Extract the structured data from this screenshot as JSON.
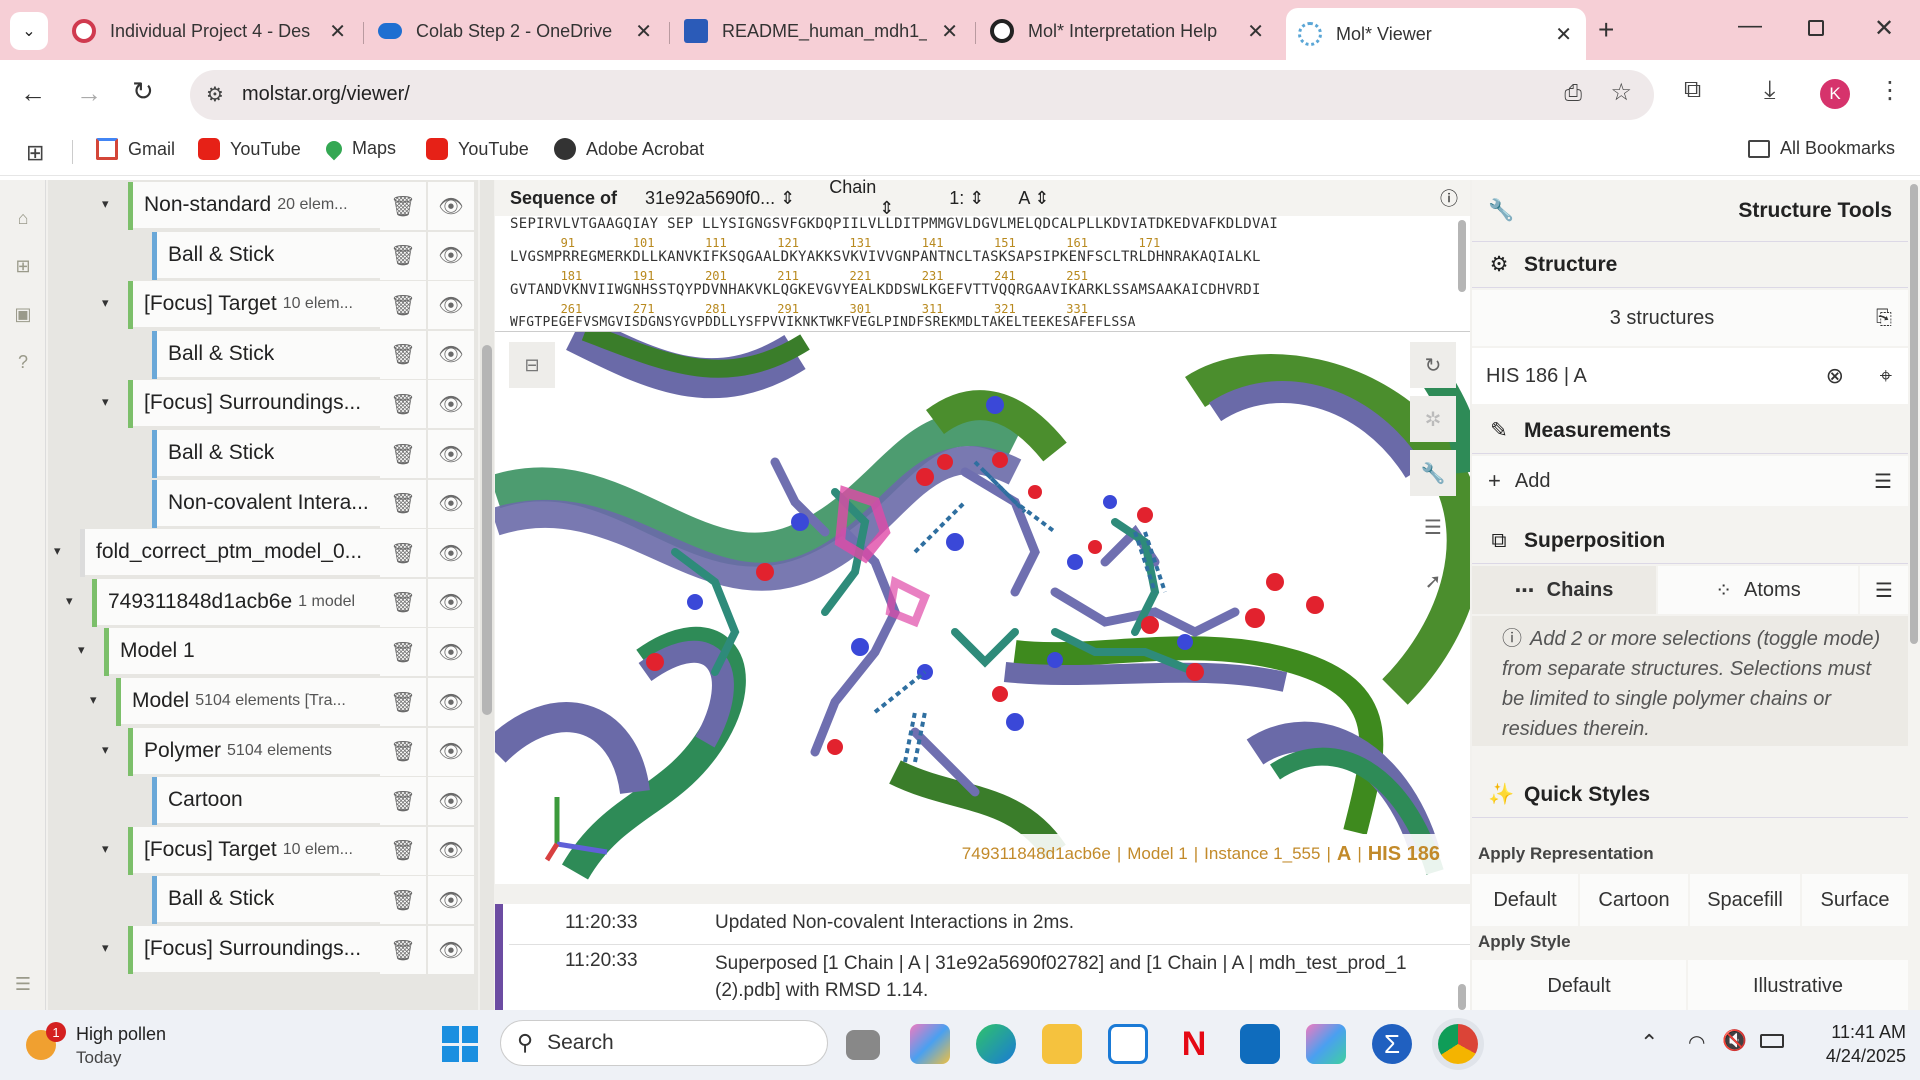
{
  "browser": {
    "tabs": [
      {
        "label": "Individual Project 4 - Des",
        "icon": "project-icon",
        "color": "#d03a4f"
      },
      {
        "label": "Colab Step 2 - OneDrive",
        "icon": "onedrive-icon",
        "color": "#1f6fd1"
      },
      {
        "label": "README_human_mdh1_",
        "icon": "word-icon",
        "color": "#2b5bb8"
      },
      {
        "label": "Mol* Interpretation Help",
        "icon": "chatgpt-icon",
        "color": "#222222"
      },
      {
        "label": "Mol* Viewer",
        "icon": "molstar-icon",
        "color": "#5aa6d6"
      }
    ],
    "url": "molstar.org/viewer/",
    "profile_initial": "K",
    "bookmarks": [
      "Gmail",
      "YouTube",
      "Maps",
      "YouTube",
      "Adobe Acrobat"
    ],
    "all_bookmarks": "All Bookmarks"
  },
  "tree": {
    "rows": [
      {
        "label": "Non-standard",
        "small": "20 elem...",
        "indent": 0,
        "arrow": true,
        "bar": "#7cbf6a"
      },
      {
        "label": "Ball & Stick",
        "small": "",
        "indent": 1,
        "arrow": false,
        "bar": "#6aa8d8"
      },
      {
        "label": "[Focus] Target",
        "small": "10 elem...",
        "indent": 0,
        "arrow": true,
        "bar": "#7cbf6a"
      },
      {
        "label": "Ball & Stick",
        "small": "",
        "indent": 1,
        "arrow": false,
        "bar": "#6aa8d8"
      },
      {
        "label": "[Focus] Surroundings...",
        "small": "",
        "indent": 0,
        "arrow": true,
        "bar": "#7cbf6a"
      },
      {
        "label": "Ball & Stick",
        "small": "",
        "indent": 1,
        "arrow": false,
        "bar": "#6aa8d8"
      },
      {
        "label": "Non-covalent Intera...",
        "small": "",
        "indent": 1,
        "arrow": false,
        "bar": "#6aa8d8"
      },
      {
        "label": "fold_correct_ptm_model_0...",
        "small": "",
        "indent": -4,
        "arrow": true,
        "bar": "#dcdcdc"
      },
      {
        "label": "749311848d1acb6e",
        "small": "1 model",
        "indent": -3,
        "arrow": true,
        "bar": "#7cbf6a"
      },
      {
        "label": "Model 1",
        "small": "",
        "indent": -2,
        "arrow": true,
        "bar": "#7cbf6a"
      },
      {
        "label": "Model",
        "small": "5104 elements [Tra...",
        "indent": -1,
        "arrow": true,
        "bar": "#7cbf6a"
      },
      {
        "label": "Polymer",
        "small": "5104 elements",
        "indent": 0,
        "arrow": true,
        "bar": "#7cbf6a"
      },
      {
        "label": "Cartoon",
        "small": "",
        "indent": 1,
        "arrow": false,
        "bar": "#6aa8d8"
      },
      {
        "label": "[Focus] Target",
        "small": "10 elem...",
        "indent": 0,
        "arrow": true,
        "bar": "#7cbf6a"
      },
      {
        "label": "Ball & Stick",
        "small": "",
        "indent": 1,
        "arrow": false,
        "bar": "#6aa8d8"
      },
      {
        "label": "[Focus] Surroundings...",
        "small": "",
        "indent": 0,
        "arrow": true,
        "bar": "#7cbf6a"
      }
    ]
  },
  "sequence": {
    "title": "Sequence of",
    "structure": "31e92a5690f0...",
    "mode": "Chain",
    "entity": "1:",
    "chain": "A",
    "lines": [
      "SEPIRVLVTGAAGQIAY SEP LLYSIGNGSVFGKDQPIILVLLDITPMMGVLDGVLMELQDCALPLLKDVIATDKEDVAFKDLDVAI",
      "LVGSMPRREGMERKDLLKANVKIFKSQGAALDKYAKKSVKVIVVGNPANTNCLTASKSAPSIPKENFSCLTRLDHNRAKAQIALKL",
      "GVTANDVKNVIIWGNHSSTQYPDVNHAKVKLQGKEVGVYEALKDDSWLKGEFVTTVQQRGAAVIKARKLSSAMSAAKAICDHVRDI",
      "WFGTPEGEFVSMGVISDGNSYGVPDDLLYSFPVVIKNKTWKFVEGLPINDFSREKMDLTAKELTEEKESAFEFLSSA"
    ],
    "numbers": [
      "       91        101       111       121       131       141       151       161       171",
      "       181       191       201       211       221       231       241       251",
      "       261       271       281       291       301       311       321       331"
    ]
  },
  "viewport": {
    "info": {
      "entry": "749311848d1acb6e",
      "model": "Model 1",
      "instance": "Instance 1_555",
      "chain": "A",
      "residue": "HIS 186"
    }
  },
  "log": [
    {
      "time": "11:20:33",
      "msg": "Updated Non-covalent Interactions in 2ms."
    },
    {
      "time": "11:20:33",
      "msg": "Superposed [1 Chain | A | 31e92a5690f02782] and [1 Chain | A | mdh_test_prod_1 (2).pdb] with RMSD 1.14."
    }
  ],
  "right": {
    "tools_title": "Structure Tools",
    "structure_title": "Structure",
    "structures_count": "3 structures",
    "selection": "HIS 186 | A",
    "measurements_title": "Measurements",
    "add_label": "Add",
    "superposition_title": "Superposition",
    "chains_tab": "Chains",
    "atoms_tab": "Atoms",
    "superposition_help": "Add 2 or more selections (toggle mode) from separate structures. Selections must be limited to single polymer chains or residues therein.",
    "quick_styles_title": "Quick Styles",
    "apply_representation": "Apply Representation",
    "rep_buttons": [
      "Default",
      "Cartoon",
      "Spacefill",
      "Surface"
    ],
    "apply_style": "Apply Style",
    "style_buttons": [
      "Default",
      "Illustrative"
    ]
  },
  "taskbar": {
    "weather_title": "High pollen",
    "weather_sub": "Today",
    "weather_badge": "1",
    "search_label": "Search",
    "time": "11:41 AM",
    "date": "4/24/2025"
  }
}
